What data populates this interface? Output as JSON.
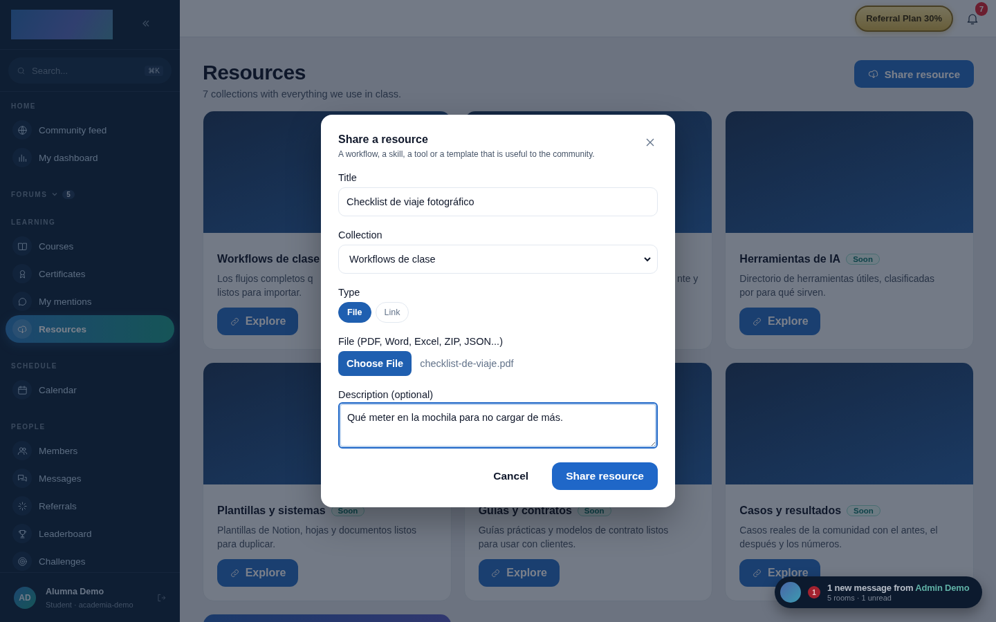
{
  "sidebar": {
    "search": {
      "placeholder": "Search...",
      "shortcut": "⌘K"
    },
    "sections": [
      {
        "heading": "HOME",
        "items": [
          {
            "label": "Community feed",
            "selected": false
          },
          {
            "label": "My dashboard",
            "selected": false
          }
        ]
      },
      {
        "heading": "FORUMS",
        "count": "5"
      },
      {
        "heading": "LEARNING",
        "items": [
          {
            "label": "Courses",
            "selected": false
          },
          {
            "label": "Certificates",
            "selected": false
          },
          {
            "label": "My mentions",
            "selected": false
          },
          {
            "label": "Resources",
            "selected": true
          }
        ]
      },
      {
        "heading": "SCHEDULE",
        "items": [
          {
            "label": "Calendar",
            "selected": false
          }
        ]
      },
      {
        "heading": "PEOPLE",
        "items": [
          {
            "label": "Members",
            "selected": false
          },
          {
            "label": "Messages",
            "selected": false
          },
          {
            "label": "Referrals",
            "selected": false
          },
          {
            "label": "Leaderboard",
            "selected": false
          },
          {
            "label": "Challenges",
            "selected": false
          }
        ]
      }
    ],
    "user": {
      "initials": "AD",
      "name": "Alumna Demo",
      "role": "Student · academia-demo"
    }
  },
  "topbar": {
    "referral": "Referral Plan 30%",
    "notification_count": "7"
  },
  "header": {
    "title": "Resources",
    "subtitle": "7 collections with everything we use in class.",
    "action": "Share resource"
  },
  "cards": [
    {
      "kind": "full",
      "title": "Workflows de clase",
      "description_lines": [
        "Los flujos completos q",
        "listos para importar."
      ],
      "button": "Explore"
    },
    {
      "kind": "full",
      "clipped": true,
      "description_lines": [
        "nte y"
      ]
    },
    {
      "kind": "full",
      "title": "Herramientas de IA",
      "badge": "Soon",
      "description_lines": [
        "Directorio de herramientas útiles, clasificadas",
        "por para qué sirven."
      ],
      "button": "Explore"
    },
    {
      "kind": "full",
      "title": "Plantillas y sistemas",
      "badge": "Soon",
      "description_lines": [
        "Plantillas de Notion, hojas y documentos listos",
        "para duplicar."
      ],
      "button": "Explore"
    },
    {
      "kind": "full",
      "title": "Guías y contratos",
      "badge": "Soon",
      "description_lines": [
        "Guías prácticas y modelos de contrato listos",
        "para usar con clientes."
      ],
      "button": "Explore"
    },
    {
      "kind": "full",
      "title": "Casos y resultados",
      "badge": "Soon",
      "description_lines": [
        "Casos reales de la comunidad con el antes, el",
        "después y los números."
      ],
      "button": "Explore"
    },
    {
      "kind": "partial"
    }
  ],
  "modal": {
    "title": "Share a resource",
    "subtitle": "A workflow, a skill, a tool or a template that is useful to the community.",
    "title_label": "Title",
    "title_value": "Checklist de viaje fotográfico",
    "collection_label": "Collection",
    "collection_value": "Workflows de clase",
    "type_label": "Type",
    "type_options": [
      {
        "label": "File",
        "selected": true
      },
      {
        "label": "Link",
        "selected": false
      }
    ],
    "file_label": "File (PDF, Word, Excel, ZIP, JSON...)",
    "file_button": "Choose File",
    "file_name": "checklist-de-viaje.pdf",
    "description_label": "Description (optional)",
    "description_value": "Qué meter en la mochila para no cargar de más.",
    "cancel": "Cancel",
    "submit": "Share resource"
  },
  "toast": {
    "message": "1 new message from",
    "sender": "Admin Demo",
    "detail": "5 rooms · 1 unread",
    "count": "1"
  }
}
